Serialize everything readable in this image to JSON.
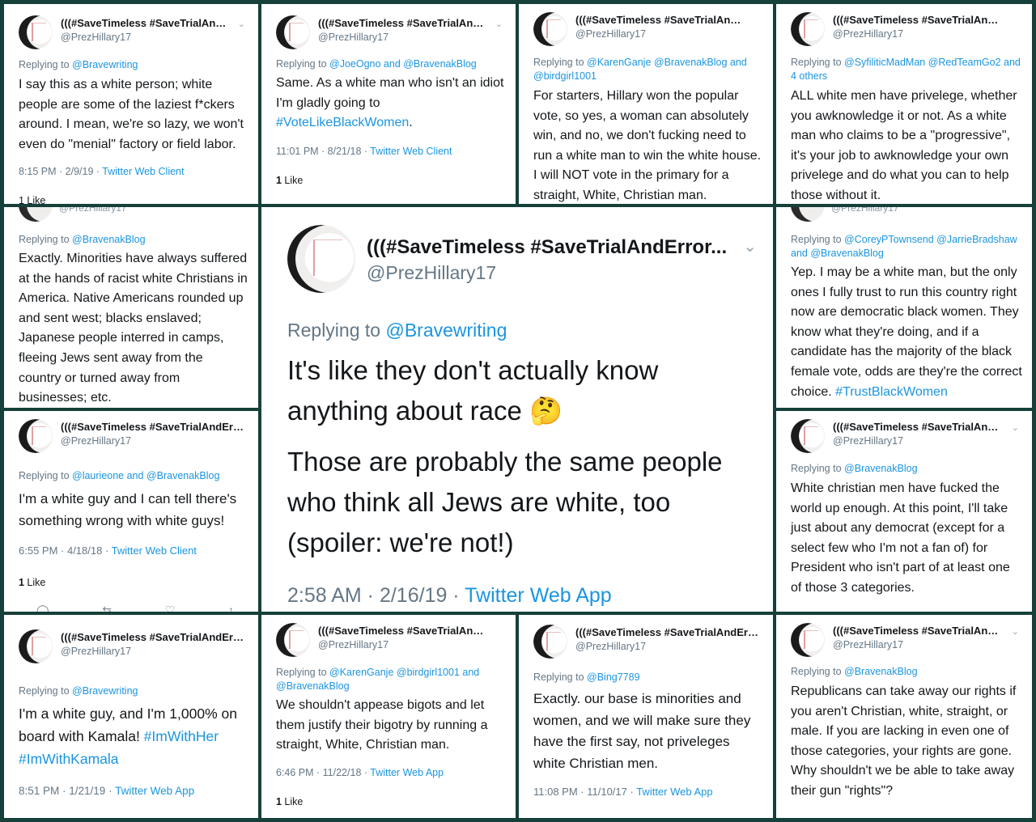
{
  "tiles": [
    {
      "name": "(((#SaveTimeless #SaveTrialAndError...",
      "handle": "@PrezHillary17",
      "reply_prefix": "Replying to ",
      "reply_to": "@Bravewriting",
      "text": "I say this as a white person; white people are some of the laziest f*ckers around. I mean, we're so lazy, we won't even do \"menial\" factory or field labor.",
      "time": "8:15 PM · 2/9/19 · ",
      "source": "Twitter Web Client",
      "likes": "1 Like"
    },
    {
      "name": "(((#SaveTimeless #SaveTrialAndError...",
      "handle": "@PrezHillary17",
      "reply_prefix": "Replying to ",
      "reply_to": "@JoeOgno and @BravenakBlog",
      "text_a": "Same. As a white man who isn't an idiot I'm gladly going to ",
      "tag": "#VoteLikeBlackWomen",
      "text_b": ".",
      "time": "11:01 PM · 8/21/18 · ",
      "source": "Twitter Web Client",
      "likes_num": "1",
      "likes_label": " Like"
    },
    {
      "name": "(((#SaveTimeless #SaveTrialAndError...",
      "handle": "@PrezHillary17",
      "reply_prefix": "Replying to ",
      "reply_to": "@KarenGanje @BravenakBlog and @birdgirl1001",
      "text": "For starters, Hillary won the popular vote, so yes, a woman can absolutely win, and no, we don't fucking need to run a white man to win the white house. I will NOT vote in the primary for a straight, White, Christian man."
    },
    {
      "name": "(((#SaveTimeless #SaveTrialAndError...",
      "handle": "@PrezHillary17",
      "reply_prefix": "Replying to ",
      "reply_to": "@SyfiliticMadMan @RedTeamGo2 and 4 others",
      "text": "ALL white men have privelege, whether you awknowledge it or not. As a white man who claims to be a \"progressive\", it's your job to awknowledge your own privelege and do what you can to help those without it."
    },
    {
      "handle": "@PrezHillary17",
      "reply_prefix": "Replying to ",
      "reply_to": "@BravenakBlog",
      "text": "Exactly. Minorities have always suffered at the hands of racist white Christians in America. Native Americans rounded up and sent west; blacks enslaved; Japanese people interred in camps, fleeing Jews sent away from the country or turned away from businesses; etc."
    },
    {
      "name": "(((#SaveTimeless #SaveTrialAndError...",
      "handle": "@PrezHillary17",
      "reply_prefix": "Replying to ",
      "reply_to": "@Bravewriting",
      "text_a": "It's like they don't actually know anything about race 🤔",
      "text_b": "Those are probably the same people who think all Jews are white, too (spoiler: we're not!)",
      "time": "2:58 AM · 2/16/19 · ",
      "source": "Twitter Web App"
    },
    {
      "handle": "@PrezHillary17",
      "reply_prefix": "Replying to ",
      "reply_to": "@CoreyPTownsend @JarrieBradshaw and @BravenakBlog",
      "text_a": "Yep. I may be a white man, but the only ones I fully trust to run this country right now are democratic black women. They know what they're doing, and if a candidate has the majority of the black female vote, odds are they're the correct choice. ",
      "tag": "#TrustBlackWomen"
    },
    {
      "name": "(((#SaveTimeless #SaveTrialAndError...",
      "handle": "@PrezHillary17",
      "reply_prefix": "Replying to ",
      "reply_to": "@laurieone and @BravenakBlog",
      "text": "I'm a white guy and I can tell there's something wrong with white guys!",
      "time": "6:55 PM · 4/18/18 · ",
      "source": "Twitter Web Client",
      "likes_num": "1",
      "likes_label": " Like"
    },
    {
      "name": "(((#SaveTimeless #SaveTrialAndError...",
      "handle": "@PrezHillary17",
      "reply_prefix": "Replying to ",
      "reply_to": "@BravenakBlog",
      "text": "White christian men have fucked the world up enough. At this point, I'll take just about any democrat (except for a select few who I'm not a fan of) for President who isn't part of at least one of those 3 categories."
    },
    {
      "name": "(((#SaveTimeless #SaveTrialAndError...",
      "handle": "@PrezHillary17",
      "reply_prefix": "Replying to ",
      "reply_to": "@Bravewriting",
      "text_a": "I'm a white guy, and I'm 1,000% on board with Kamala! ",
      "tag1": "#ImWithHer",
      "tag2": "#ImWithKamala",
      "time": "8:51 PM · 1/21/19 · ",
      "source": "Twitter Web App"
    },
    {
      "name": "(((#SaveTimeless #SaveTrialAndError...",
      "handle": "@PrezHillary17",
      "reply_prefix": "Replying to ",
      "reply_to": "@KarenGanje @birdgirl1001 and @BravenakBlog",
      "text": "We shouldn't appease bigots and let them justify their bigotry by running a straight, White, Christian man.",
      "time": "6:46 PM · 11/22/18 · ",
      "source": "Twitter Web App",
      "likes_num": "1",
      "likes_label": " Like"
    },
    {
      "name": "(((#SaveTimeless #SaveTrialAndError...",
      "handle": "@PrezHillary17",
      "reply_prefix": "Replying to ",
      "reply_to": "@Bing7789",
      "text": "Exactly. our base is minorities and women, and we will make sure they have the first say, not priveleges white Christian men.",
      "time": "11:08 PM · 11/10/17 · ",
      "source": "Twitter Web App"
    },
    {
      "name": "(((#SaveTimeless #SaveTrialAndError...",
      "handle": "@PrezHillary17",
      "reply_prefix": "Replying to ",
      "reply_to": "@BravenakBlog",
      "text": "Republicans can take away our rights if you aren't Christian, white, straight, or male. If you are lacking in even one of those categories, your rights are gone. Why shouldn't we be able to take away their gun \"rights\"?"
    }
  ]
}
